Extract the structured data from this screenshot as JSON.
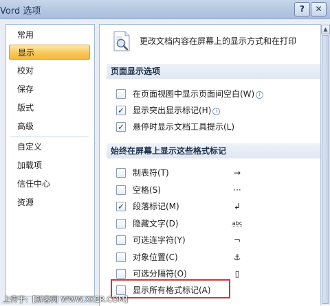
{
  "window": {
    "title": "Vord 选项",
    "help_label": "?",
    "close_label": "✕"
  },
  "nav": {
    "items": [
      {
        "label": "常用"
      },
      {
        "label": "显示",
        "selected": true
      },
      {
        "label": "校对"
      },
      {
        "label": "保存"
      },
      {
        "label": "版式"
      },
      {
        "label": "高级"
      },
      {
        "label": "自定义"
      },
      {
        "label": "加载项"
      },
      {
        "label": "信任中心"
      },
      {
        "label": "资源"
      }
    ]
  },
  "main": {
    "header": {
      "icon": "magnifier-document-icon",
      "text": "更改文档内容在屏幕上的显示方式和在打印"
    },
    "section1": {
      "title": "页面显示选项",
      "options": [
        {
          "label": "在页面视图中显示页面间空白(W)",
          "checked": false,
          "info": true
        },
        {
          "label": "显示突出显示标记(H)",
          "checked": true,
          "info": true
        },
        {
          "label": "悬停时显示文档工具提示(L)",
          "checked": true,
          "info": false
        }
      ]
    },
    "section2": {
      "title": "始终在屏幕上显示这些格式标记",
      "options": [
        {
          "label": "制表符(T)",
          "checked": false,
          "symbol": "→"
        },
        {
          "label": "空格(S)",
          "checked": false,
          "symbol": "···"
        },
        {
          "label": "段落标记(M)",
          "checked": true,
          "symbol": "↲"
        },
        {
          "label": "隐藏文字(D)",
          "checked": false,
          "symbol": "abc"
        },
        {
          "label": "可选连字符(Y)",
          "checked": false,
          "symbol": "¬"
        },
        {
          "label": "对象位置(C)",
          "checked": false,
          "symbol": "⚓"
        },
        {
          "label": "可选分隔符(O)",
          "checked": false,
          "symbol": "▯"
        },
        {
          "label": "显示所有格式标记(A)",
          "checked": false,
          "symbol": "",
          "highlighted": true
        }
      ]
    }
  },
  "footer": {
    "text": "上传于:【新客网 WWW.XKER.COM】"
  },
  "colors": {
    "highlight_box": "#d13434",
    "nav_selected": "#f8c85c"
  }
}
